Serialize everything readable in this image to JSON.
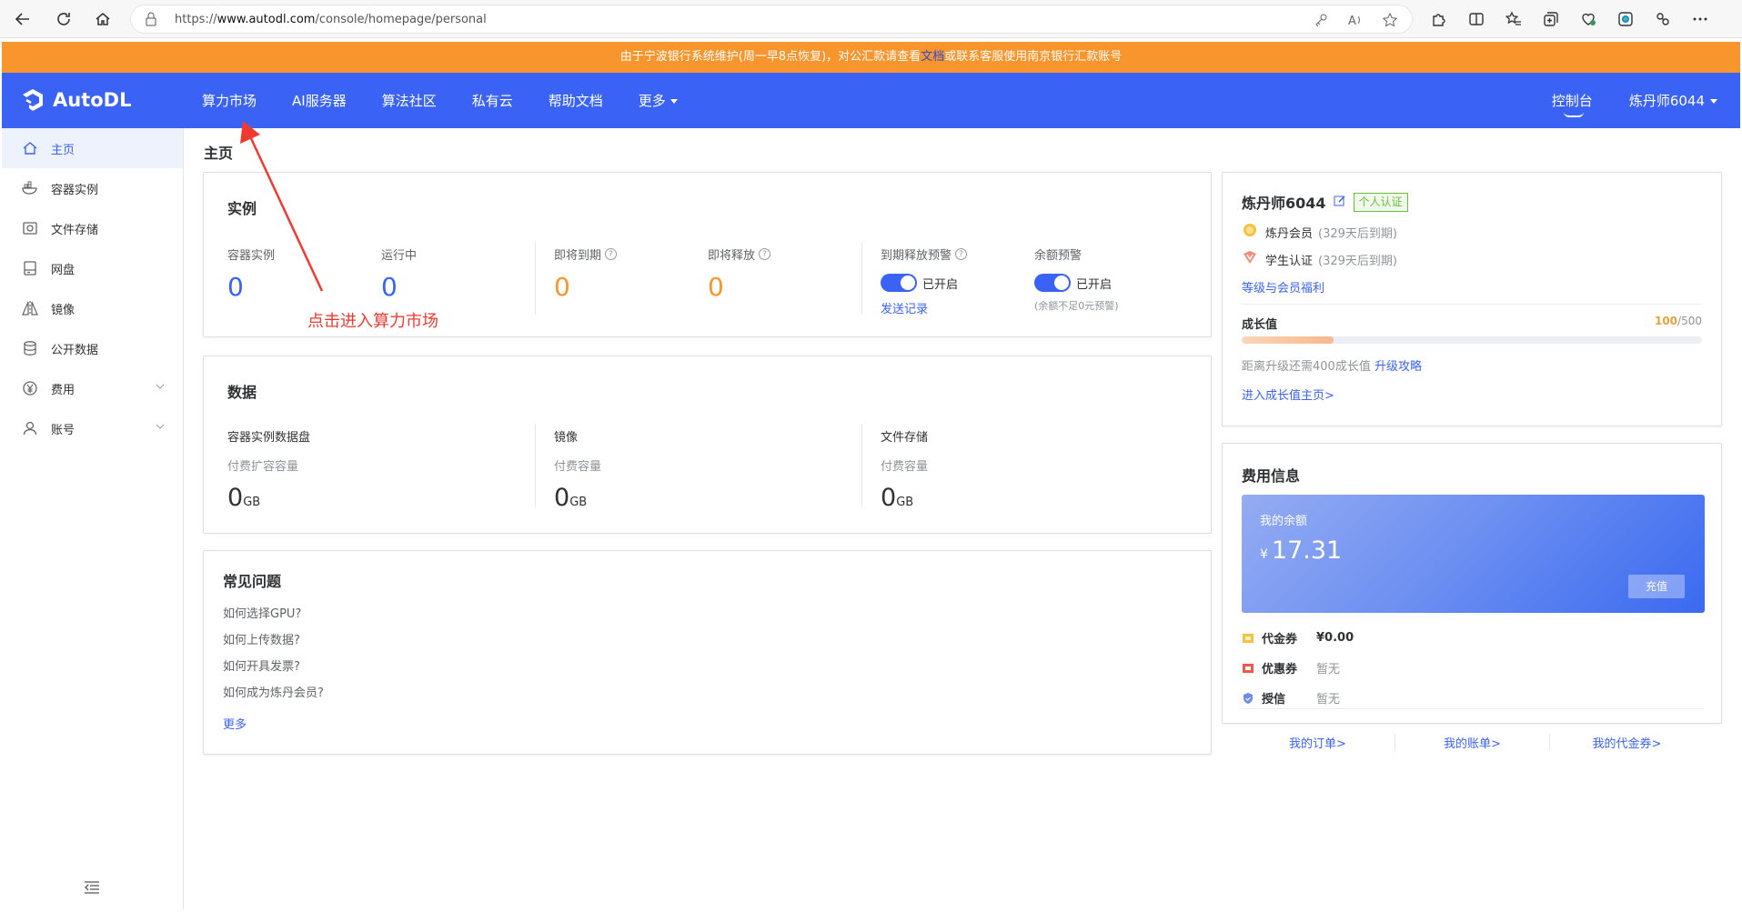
{
  "browser": {
    "url_prefix": "https://",
    "url_host": "www.autodl.com",
    "url_path": "/console/homepage/personal"
  },
  "notice": {
    "text_before": "由于宁波银行系统维护(周一早8点恢复)，对公汇款请查看",
    "link": "文档",
    "text_after": "或联系客服使用南京银行汇款账号"
  },
  "nav": {
    "logo": "AutoDL",
    "items": [
      "算力市场",
      "AI服务器",
      "算法社区",
      "私有云",
      "帮助文档",
      "更多"
    ],
    "console": "控制台",
    "user": "炼丹师6044"
  },
  "sidebar": {
    "items": [
      {
        "label": "主页",
        "icon": "home-icon"
      },
      {
        "label": "容器实例",
        "icon": "container-icon"
      },
      {
        "label": "文件存储",
        "icon": "file-storage-icon"
      },
      {
        "label": "网盘",
        "icon": "netdisk-icon"
      },
      {
        "label": "镜像",
        "icon": "image-icon"
      },
      {
        "label": "公开数据",
        "icon": "database-icon"
      },
      {
        "label": "费用",
        "icon": "yen-icon"
      },
      {
        "label": "账号",
        "icon": "user-icon"
      }
    ]
  },
  "page_title": "主页",
  "instances": {
    "title": "实例",
    "stats": [
      {
        "label": "容器实例",
        "value": "0"
      },
      {
        "label": "运行中",
        "value": "0"
      },
      {
        "label": "即将到期",
        "value": "0"
      },
      {
        "label": "即将释放",
        "value": "0"
      }
    ],
    "release_alert": {
      "label": "到期释放预警",
      "state": "已开启",
      "link": "发送记录"
    },
    "balance_alert": {
      "label": "余额预警",
      "state": "已开启",
      "note": "(余额不足0元预警)"
    }
  },
  "data_section": {
    "title": "数据",
    "cols": [
      {
        "head": "容器实例数据盘",
        "sub": "付费扩容容量",
        "value": "0",
        "unit": "GB"
      },
      {
        "head": "镜像",
        "sub": "付费容量",
        "value": "0",
        "unit": "GB"
      },
      {
        "head": "文件存储",
        "sub": "付费容量",
        "value": "0",
        "unit": "GB"
      }
    ]
  },
  "faq": {
    "title": "常见问题",
    "items": [
      "如何选择GPU?",
      "如何上传数据?",
      "如何开具发票?",
      "如何成为炼丹会员?"
    ],
    "more": "更多"
  },
  "profile": {
    "name": "炼丹师6044",
    "cert": "个人认证",
    "member": "炼丹会员",
    "member_note": "(329天后到期)",
    "student": "学生认证",
    "student_note": "(329天后到期)",
    "benefits_link": "等级与会员福利",
    "growth_label": "成长值",
    "growth_value": "100",
    "growth_max": "/500",
    "growth_fraction": 0.2,
    "upgrade_text": "距离升级还需400成长值",
    "upgrade_link": "升级攻略",
    "growth_home": "进入成长值主页>"
  },
  "fee": {
    "title": "费用信息",
    "balance_label": "我的余额",
    "currency": "¥",
    "balance": "17.31",
    "recharge": "充值",
    "rows": [
      {
        "name": "代金券",
        "value": "¥0.00",
        "color": "#f5c242"
      },
      {
        "name": "优惠券",
        "value": "暂无",
        "color": "#ec5a4a"
      },
      {
        "name": "授信",
        "value": "暂无",
        "color": "#6b8af0"
      }
    ],
    "links": [
      "我的订单>",
      "我的账单>",
      "我的代金券>"
    ]
  },
  "annotation": "点击进入算力市场",
  "colors": {
    "primary": "#3a63f5",
    "notice": "#f8952d",
    "annotation": "#f03a2f"
  }
}
